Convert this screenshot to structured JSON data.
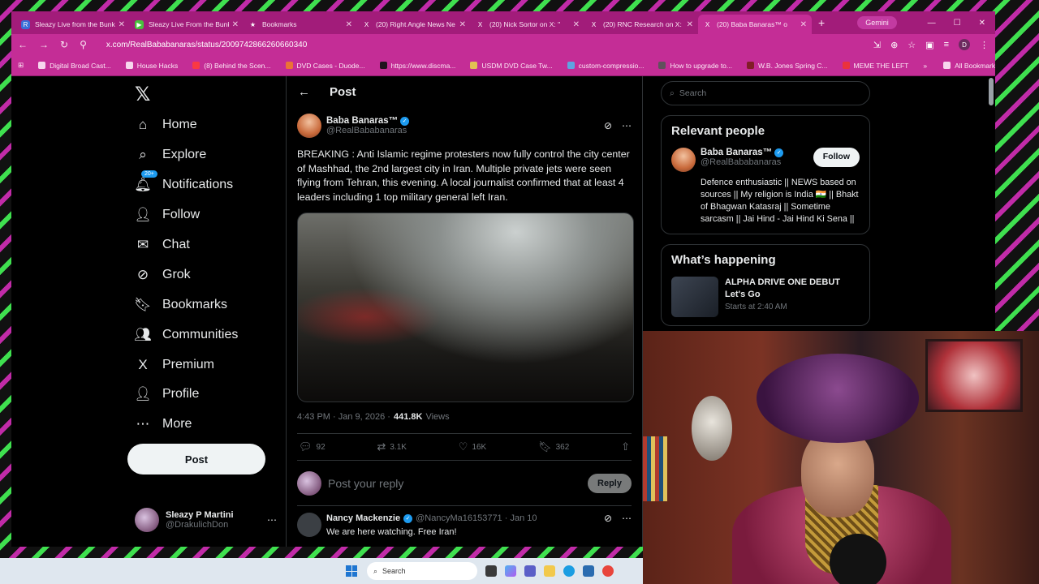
{
  "browser": {
    "tabs": [
      {
        "title": "Sleazy Live from the Bunk",
        "icon": "R",
        "color": "#3a6fd8"
      },
      {
        "title": "Sleazy Live From the Bunk",
        "icon": "▶",
        "color": "#49c13d"
      },
      {
        "title": "Bookmarks",
        "icon": "★",
        "color": "#a21c7a"
      },
      {
        "title": "(20) Right Angle News Ne",
        "icon": "X",
        "color": "#000000"
      },
      {
        "title": "(20) Nick Sortor on X: \"",
        "icon": "X",
        "color": "#000000"
      },
      {
        "title": "(20) RNC Research on X: \"",
        "icon": "X",
        "color": "#000000"
      },
      {
        "title": "(20) Baba Banaras™ o",
        "icon": "X",
        "color": "#000000"
      }
    ],
    "gemini_label": "Gemini",
    "url": "x.com/RealBababanaras/status/2009742866260660340",
    "profile_initial": "D",
    "bookmarks": [
      "Digital Broad Cast...",
      "House Hacks",
      "(8) Behind the Scen...",
      "DVD Cases - Duode...",
      "https://www.discma...",
      "USDM DVD Case Tw...",
      "custom-compressio...",
      "How to upgrade to...",
      "W.B. Jones Spring C...",
      "MEME THE LEFT"
    ],
    "all_bookmarks": "All Bookmarks"
  },
  "nav": {
    "items": [
      {
        "label": "Home",
        "icon": "⌂"
      },
      {
        "label": "Explore",
        "icon": "⌕"
      },
      {
        "label": "Notifications",
        "icon": "🔔︎"
      },
      {
        "label": "Follow",
        "icon": "👤︎"
      },
      {
        "label": "Chat",
        "icon": "✉"
      },
      {
        "label": "Grok",
        "icon": "⊘"
      },
      {
        "label": "Bookmarks",
        "icon": "🔖︎"
      },
      {
        "label": "Communities",
        "icon": "👥︎"
      },
      {
        "label": "Premium",
        "icon": "X"
      },
      {
        "label": "Profile",
        "icon": "👤︎"
      },
      {
        "label": "More",
        "icon": "⋯"
      }
    ],
    "notifications_badge": "20+",
    "post_button": "Post",
    "account": {
      "name": "Sleazy P Martini",
      "handle": "@DrakulichDon"
    }
  },
  "post": {
    "header": "Post",
    "author": "Baba Banaras™",
    "handle": "@RealBababanaras",
    "text": "BREAKING : Anti Islamic regime protesters now fully control the city center of Mashhad, the 2nd largest city in Iran. Multiple private jets were seen flying from Tehran, this evening. A local journalist confirmed that at least 4 leaders including 1 top military general left Iran.",
    "time": "4:43 PM · Jan 9, 2026 ·",
    "views_count": "441.8K",
    "views_label": "Views",
    "replies": "92",
    "reposts": "3.1K",
    "likes": "16K",
    "bookmarks": "362",
    "reply_placeholder": "Post your reply",
    "reply_button": "Reply"
  },
  "reply": {
    "author": "Nancy Mackenzie",
    "handle": "@NancyMa16153771 · Jan 10",
    "text": "We are here watching. Free Iran!"
  },
  "sidebar": {
    "search_placeholder": "Search",
    "relevant_title": "Relevant people",
    "person": {
      "name": "Baba Banaras™",
      "handle": "@RealBababanaras",
      "follow": "Follow",
      "bio": "Defence enthusiastic || NEWS based on sources || My religion is India 🇮🇳 || Bhakt of Bhagwan Katasraj || Sometime sarcasm || Jai Hind - Jai Hind Ki Sena ||"
    },
    "happening_title": "What’s happening",
    "trend": {
      "title": "ALPHA DRIVE ONE DEBUT Let's Go",
      "meta": "Starts at 2:40 AM"
    }
  },
  "taskbar": {
    "search": "Search"
  }
}
